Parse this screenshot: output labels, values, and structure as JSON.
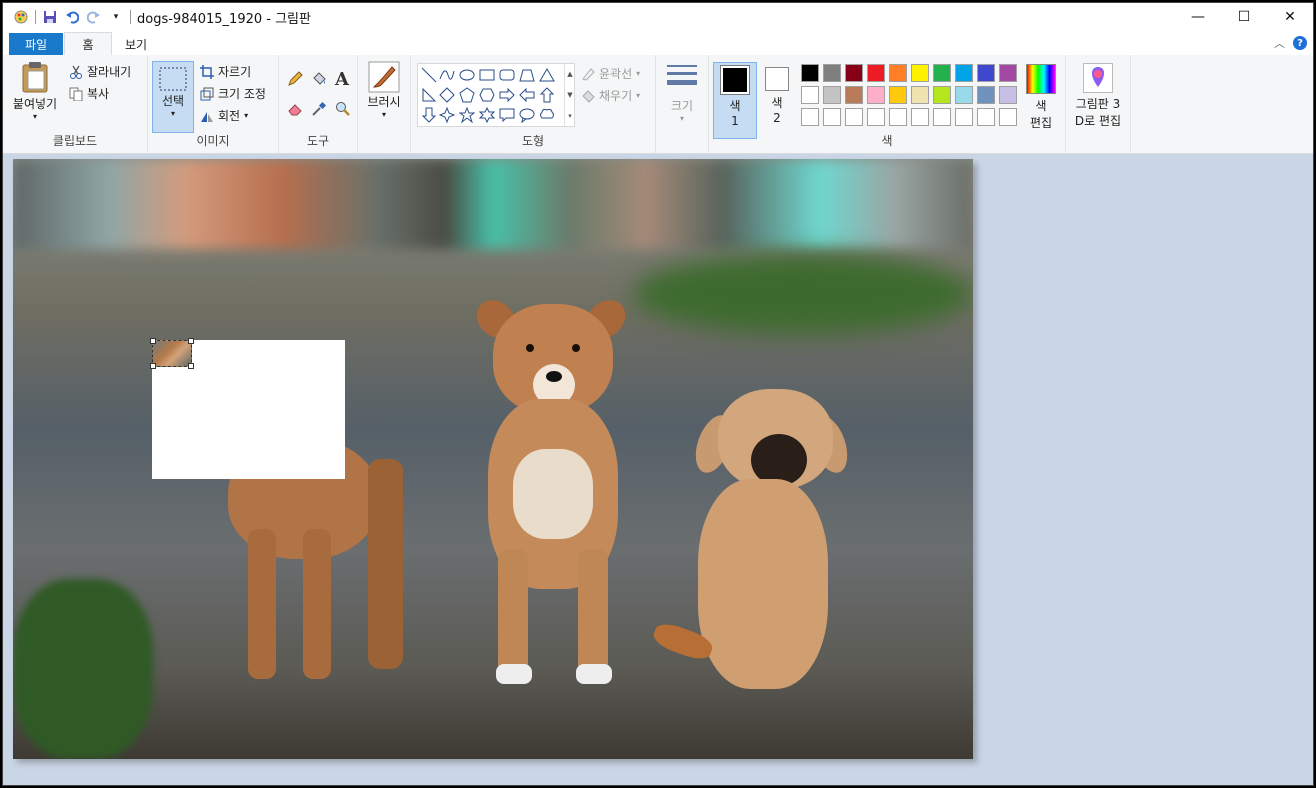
{
  "titlebar": {
    "title": "dogs-984015_1920 - 그림판"
  },
  "tabs": {
    "file": "파일",
    "home": "홈",
    "view": "보기"
  },
  "clipboard": {
    "paste": "붙여넣기",
    "cut": "잘라내기",
    "copy": "복사",
    "label": "클립보드"
  },
  "image": {
    "select": "선택",
    "crop": "자르기",
    "resize": "크기 조정",
    "rotate": "회전",
    "label": "이미지"
  },
  "tools": {
    "label": "도구"
  },
  "brushes": {
    "label": "브러시"
  },
  "shapes": {
    "outline": "윤곽선",
    "fill": "채우기",
    "label": "도형"
  },
  "size": {
    "label": "크기"
  },
  "colors": {
    "color1": "색\n1",
    "color1_top": "색",
    "color1_bottom": "1",
    "color2_top": "색",
    "color2_bottom": "2",
    "edit_top": "색",
    "edit_bottom": "편집",
    "label": "색",
    "palette_row1": [
      "#000000",
      "#7f7f7f",
      "#880015",
      "#ed1c24",
      "#ff7f27",
      "#fff200",
      "#22b14c",
      "#00a2e8",
      "#3f48cc",
      "#a349a4"
    ],
    "palette_row2": [
      "#ffffff",
      "#c3c3c3",
      "#b97a57",
      "#ffaec9",
      "#ffc90e",
      "#efe4b0",
      "#b5e61d",
      "#99d9ea",
      "#7092be",
      "#c8bfe7"
    ],
    "palette_row3": [
      "#ffffff",
      "#ffffff",
      "#ffffff",
      "#ffffff",
      "#ffffff",
      "#ffffff",
      "#ffffff",
      "#ffffff",
      "#ffffff",
      "#ffffff"
    ]
  },
  "paint3d": {
    "line1": "그림판 3",
    "line2": "D로 편집"
  }
}
